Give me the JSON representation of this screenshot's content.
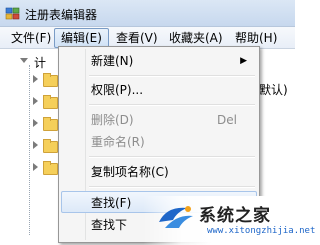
{
  "window": {
    "title": "注册表编辑器",
    "icon": "registry-editor-icon"
  },
  "menubar": {
    "items": [
      {
        "label": "文件(F)"
      },
      {
        "label": "编辑(E)",
        "active": true
      },
      {
        "label": "查看(V)"
      },
      {
        "label": "收藏夹(A)"
      },
      {
        "label": "帮助(H)"
      }
    ]
  },
  "tree": {
    "root_partial": "计",
    "value_partial": "默认)"
  },
  "edit_menu": {
    "items": [
      {
        "label": "新建(N)",
        "submenu": true
      },
      {
        "label": "权限(P)..."
      },
      {
        "label": "删除(D)",
        "shortcut": "Del",
        "disabled": true
      },
      {
        "label": "重命名(R)",
        "disabled": true
      },
      {
        "label": "复制项名称(C)"
      },
      {
        "label": "查找(F)",
        "highlighted": true
      },
      {
        "label": "查找下"
      }
    ]
  },
  "watermark": {
    "text": "系统之家",
    "url": "www.xitongzhijia.net"
  },
  "colors": {
    "accent": "#1f67c9",
    "menu_hover_border": "#a8c5ea",
    "folder": "#f5cf5a"
  }
}
